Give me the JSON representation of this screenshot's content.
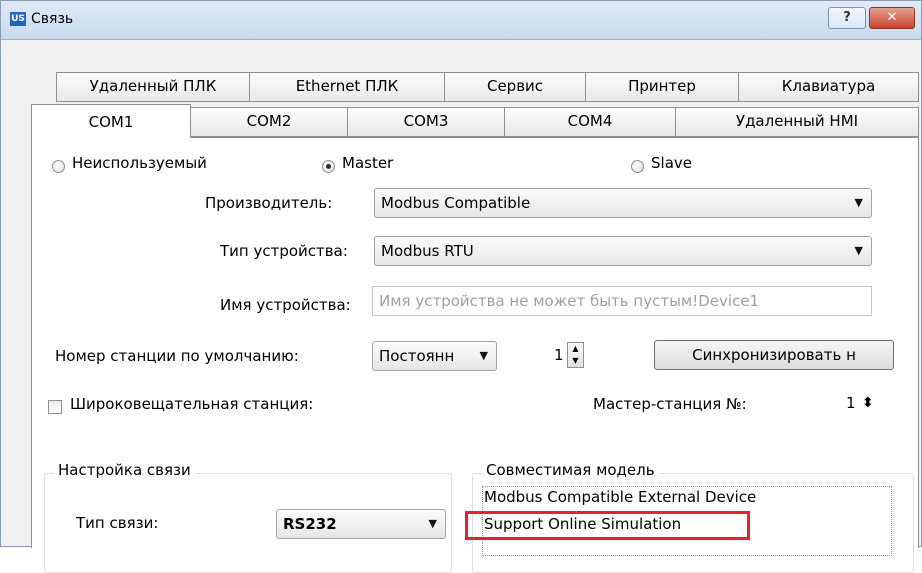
{
  "window": {
    "app_icon_text": "US",
    "title": "Связь",
    "help_label": "?",
    "close_label": "✕"
  },
  "tabs_row1": [
    "Удаленный ПЛК",
    "Ethernet ПЛК",
    "Сервис",
    "Принтер",
    "Клавиатура"
  ],
  "tabs_row2": [
    "COM1",
    "COM2",
    "COM3",
    "COM4",
    "Удаленный HMI"
  ],
  "active_tab": "COM1",
  "mode": {
    "options": [
      "Неиспользуемый",
      "Master",
      "Slave"
    ],
    "selected": "Master"
  },
  "form": {
    "manufacturer_label": "Производитель:",
    "manufacturer_value": "Modbus Compatible",
    "device_type_label": "Тип устройства:",
    "device_type_value": "Modbus RTU",
    "device_name_label": "Имя устройства:",
    "device_name_value": "Имя устройства не может быть пустым!Device1",
    "station_label": "Номер станции по умолчанию:",
    "station_mode_value": "Постоянн",
    "station_number": "1",
    "sync_button": "Синхронизировать н",
    "broadcast_label": "Широковещательная станция:",
    "broadcast_checked": false,
    "master_station_label": "Мастер-станция №:",
    "master_station_value": "1"
  },
  "comm_settings": {
    "title": "Настройка связи",
    "type_label": "Тип связи:",
    "type_value": "RS232"
  },
  "compatible_model": {
    "title": "Совместимая модель",
    "items": [
      "Modbus Compatible External Device",
      "Support Online Simulation"
    ],
    "highlighted_item": "Support Online Simulation",
    "highlight_color": "#e8222a"
  },
  "colors": {
    "titlebar": "#c9daef",
    "close_button": "#c7452d"
  }
}
